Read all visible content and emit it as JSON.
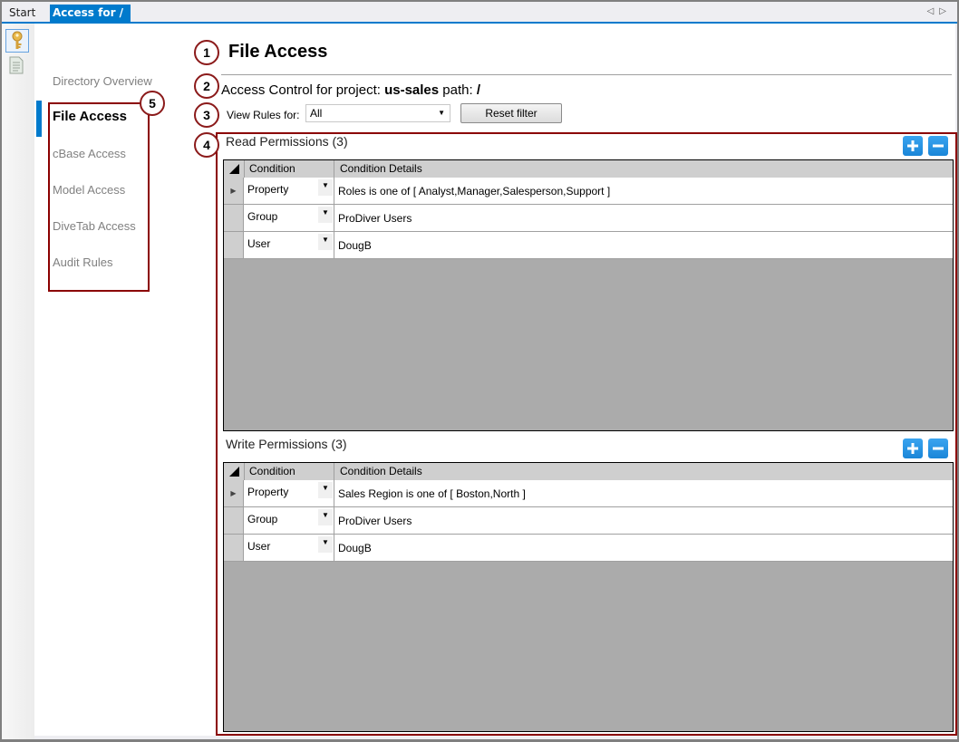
{
  "tabs": [
    {
      "label": "Start",
      "active": false
    },
    {
      "label": "Access for /",
      "active": true,
      "close_glyph": "✕"
    }
  ],
  "tab_nav": {
    "prev_glyph": "◁",
    "next_glyph": "▷"
  },
  "left_toolbar": [
    {
      "icon": "key-icon",
      "selected": true
    },
    {
      "icon": "document-icon",
      "selected": false
    }
  ],
  "sidebar": {
    "items": [
      {
        "label": "Directory Overview",
        "active": false
      },
      {
        "label": "File Access",
        "active": true
      },
      {
        "label": "cBase Access",
        "active": false
      },
      {
        "label": "Model Access",
        "active": false
      },
      {
        "label": "DiveTab Access",
        "active": false
      },
      {
        "label": "Audit Rules",
        "active": false
      }
    ]
  },
  "callouts": [
    "1",
    "2",
    "3",
    "4",
    "5"
  ],
  "header": {
    "title": "File Access",
    "subtitle_prefix": "Access Control for project: ",
    "project": "us-sales",
    "path_label": " path: ",
    "path": "/"
  },
  "filter": {
    "label": "View Rules for:",
    "selected": "All",
    "reset_label": "Reset filter"
  },
  "columns": {
    "condition": "Condition",
    "details": "Condition Details"
  },
  "read": {
    "title": "Read Permissions (3)",
    "rows": [
      {
        "condition": "Property",
        "details": "Roles is one of [ Analyst,Manager,Salesperson,Support ]"
      },
      {
        "condition": "Group",
        "details": "ProDiver Users"
      },
      {
        "condition": "User",
        "details": "DougB"
      }
    ]
  },
  "write": {
    "title": "Write Permissions (3)",
    "rows": [
      {
        "condition": "Property",
        "details": "Sales Region is one of [ Boston,North ]"
      },
      {
        "condition": "Group",
        "details": "ProDiver Users"
      },
      {
        "condition": "User",
        "details": "DougB"
      }
    ]
  },
  "colors": {
    "accent": "#007acc",
    "callout": "#8b1a1a",
    "grid_bg": "#ababab",
    "add_remove": "#1a86d8"
  }
}
